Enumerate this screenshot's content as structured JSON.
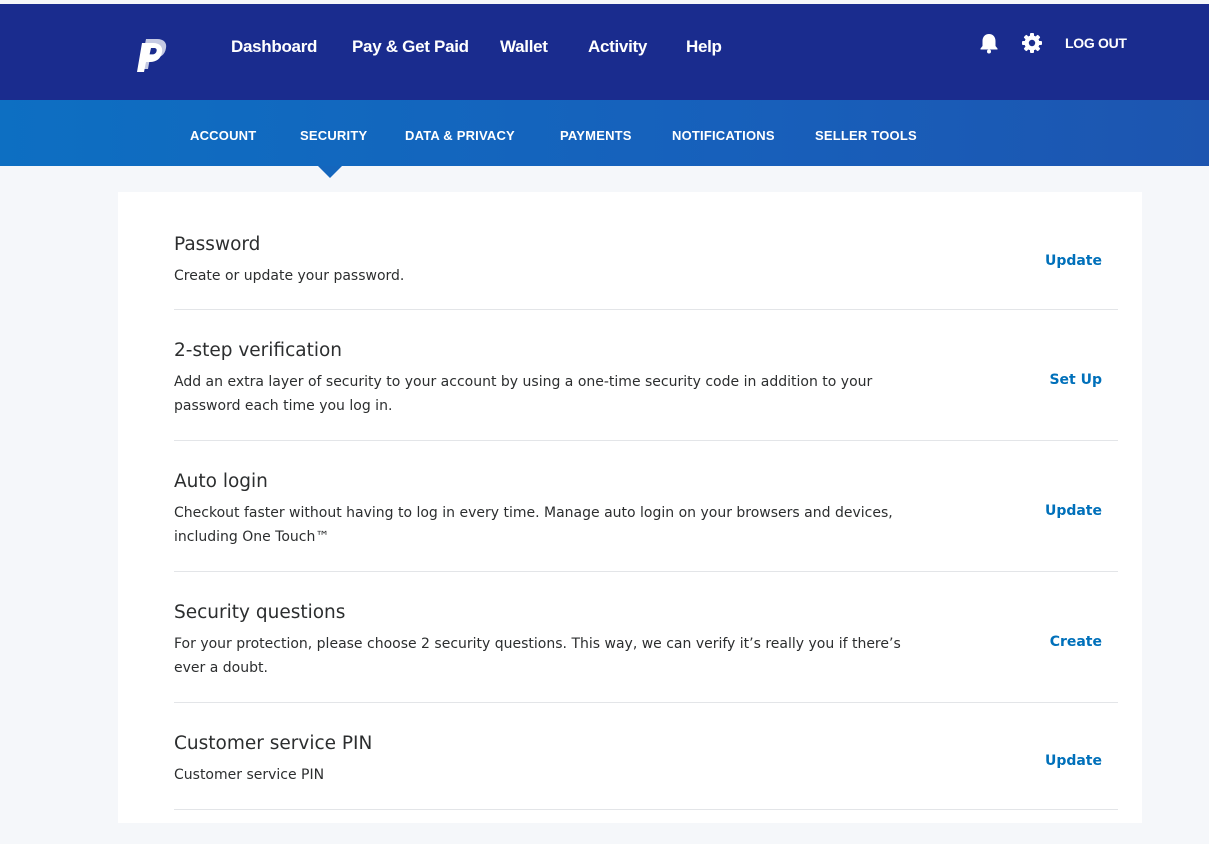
{
  "header": {
    "nav": [
      "Dashboard",
      "Pay & Get Paid",
      "Wallet",
      "Activity",
      "Help"
    ],
    "logout_label": "LOG OUT",
    "icons": {
      "logo": "paypal-logo-icon",
      "notifications": "bell-icon",
      "settings": "gear-icon"
    }
  },
  "subnav": {
    "tabs": [
      "ACCOUNT",
      "SECURITY",
      "DATA & PRIVACY",
      "PAYMENTS",
      "NOTIFICATIONS",
      "SELLER TOOLS"
    ],
    "active": "SECURITY"
  },
  "security": {
    "rows": [
      {
        "title": "Password",
        "description": "Create or update your password.",
        "action": "Update"
      },
      {
        "title": "2-step verification",
        "description": "Add an extra layer of security to your account by using a one-time security code in addition to your password each time you log in.",
        "action": "Set Up"
      },
      {
        "title": "Auto login",
        "description": "Checkout faster without having to log in every time. Manage auto login on your browsers and devices, including One Touch™",
        "action": "Update"
      },
      {
        "title": "Security questions",
        "description": "For your protection, please choose 2 security questions. This way, we can verify it’s really you if there’s ever a doubt.",
        "action": "Create"
      },
      {
        "title": "Customer service PIN",
        "description": "Customer service PIN",
        "action": "Update"
      }
    ]
  },
  "colors": {
    "header_bg": "#1a2c8e",
    "subnav_bg": "#1466bd",
    "link": "#0070ba",
    "text": "#2c2e2f"
  }
}
